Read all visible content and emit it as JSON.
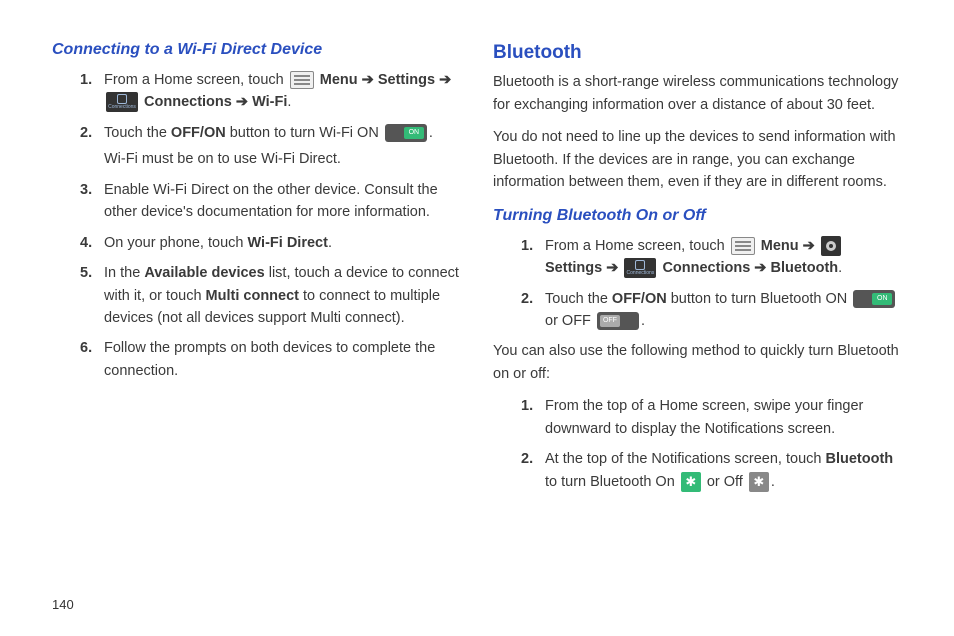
{
  "page_number": "140",
  "left": {
    "heading": "Connecting to a Wi-Fi Direct Device",
    "steps": [
      {
        "num": "1.",
        "pre": "From a Home screen, touch ",
        "menu": "Menu",
        "settings": "Settings",
        "connections": "Connections",
        "wifi": "Wi-Fi",
        "sep": " ➔ ",
        "end": "."
      },
      {
        "num": "2.",
        "pre": "Touch the ",
        "b1": "OFF/ON",
        "mid": " button to turn Wi-Fi ON ",
        "end": ".",
        "note": "Wi-Fi must be on to use Wi-Fi Direct."
      },
      {
        "num": "3.",
        "text": "Enable Wi-Fi Direct on the other device. Consult the other device's documentation for more information."
      },
      {
        "num": "4.",
        "pre": "On your phone, touch ",
        "b1": "Wi-Fi Direct",
        "end": "."
      },
      {
        "num": "5.",
        "pre": "In the ",
        "b1": "Available devices",
        "mid1": " list, touch a device to connect with it, or touch ",
        "b2": "Multi connect",
        "mid2": " to connect to multiple devices (not all devices support Multi connect)."
      },
      {
        "num": "6.",
        "text": "Follow the prompts on both devices to complete the connection."
      }
    ]
  },
  "right": {
    "heading": "Bluetooth",
    "intro1": "Bluetooth is a short-range wireless communications technology for exchanging information over a distance of about 30 feet.",
    "intro2": "You do not need to line up the devices to send information with Bluetooth. If the devices are in range, you can exchange information between them, even if they are in different rooms.",
    "sub": "Turning Bluetooth On or Off",
    "stepsA": [
      {
        "num": "1.",
        "pre": "From a Home screen, touch ",
        "menu": "Menu",
        "settings": "Settings",
        "connections": "Connections",
        "bluetooth": "Bluetooth",
        "sep": " ➔ ",
        "end": "."
      },
      {
        "num": "2.",
        "pre": "Touch the ",
        "b1": "OFF/ON",
        "mid": " button to turn Bluetooth ON ",
        "or": " or OFF ",
        "end": "."
      }
    ],
    "also": "You can also use the following method to quickly turn Bluetooth on or off:",
    "stepsB": [
      {
        "num": "1.",
        "text": "From the top of a Home screen, swipe your finger downward to display the Notifications screen."
      },
      {
        "num": "2.",
        "pre": "At the top of the Notifications screen, touch ",
        "b1": "Bluetooth",
        "mid": " to turn Bluetooth On ",
        "or": " or Off ",
        "end": "."
      }
    ]
  }
}
